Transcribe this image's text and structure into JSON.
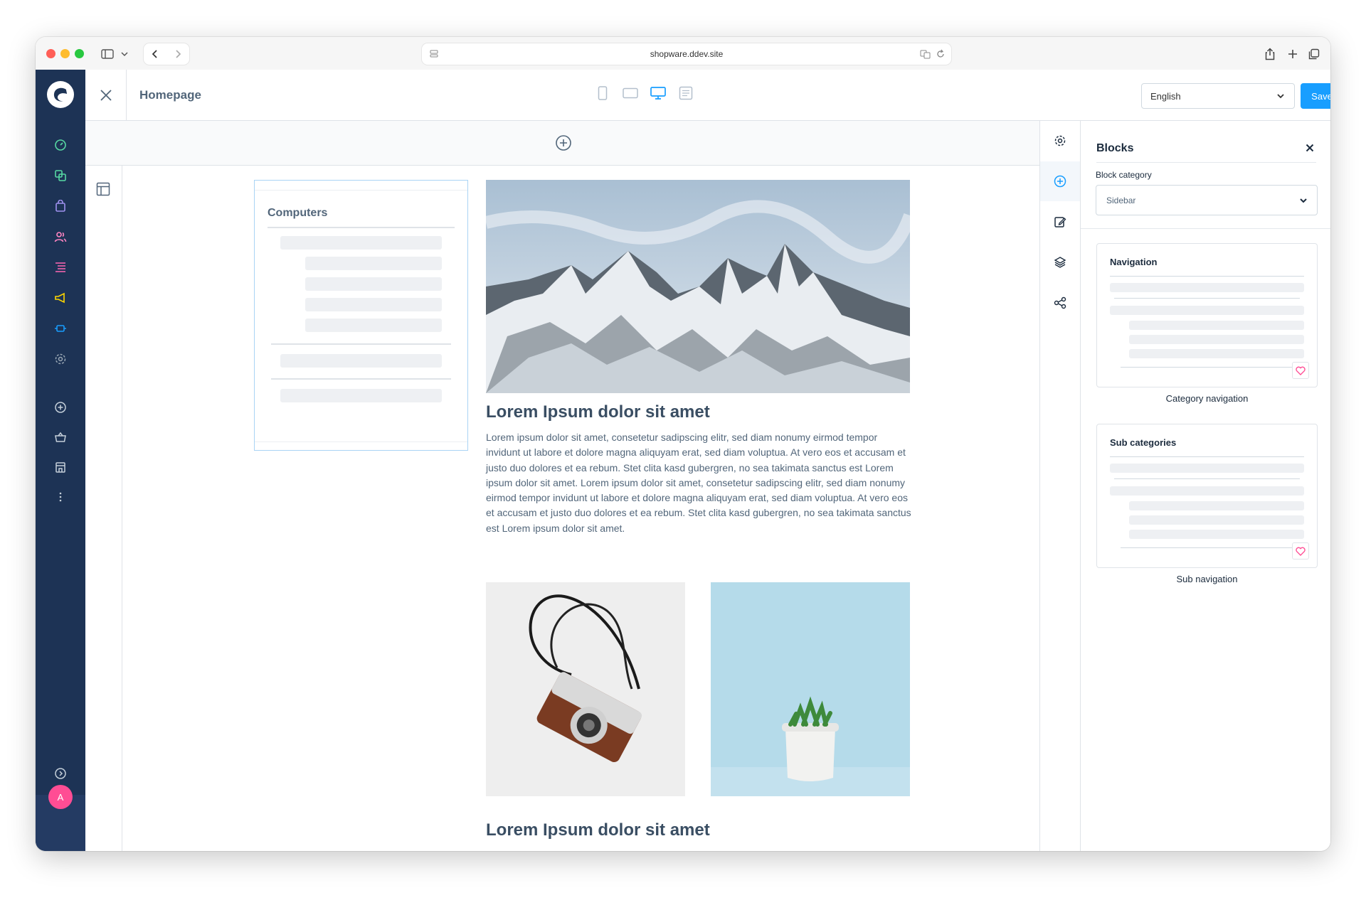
{
  "browser": {
    "url": "shopware.ddev.site"
  },
  "header": {
    "page_title": "Homepage",
    "language": "English",
    "save_label": "Save"
  },
  "content": {
    "category_block_title": "Computers",
    "heading_1": "Lorem Ipsum dolor sit amet",
    "paragraph": "Lorem ipsum dolor sit amet, consetetur sadipscing elitr, sed diam nonumy eirmod tempor invidunt ut labore et dolore magna aliquyam erat, sed diam voluptua. At vero eos et accusam et justo duo dolores et ea rebum. Stet clita kasd gubergren, no sea takimata sanctus est Lorem ipsum dolor sit amet. Lorem ipsum dolor sit amet, consetetur sadipscing elitr, sed diam nonumy eirmod tempor invidunt ut labore et dolore magna aliquyam erat, sed diam voluptua. At vero eos et accusam et justo duo dolores et ea rebum. Stet clita kasd gubergren, no sea takimata sanctus est Lorem ipsum dolor sit amet.",
    "heading_2": "Lorem Ipsum dolor sit amet"
  },
  "blocks_panel": {
    "title": "Blocks",
    "category_label": "Block category",
    "category_value": "Sidebar",
    "cards": [
      {
        "title": "Navigation",
        "caption": "Category navigation"
      },
      {
        "title": "Sub categories",
        "caption": "Sub navigation"
      }
    ]
  },
  "user": {
    "avatar_initial": "A"
  },
  "colors": {
    "sidebar": "#1d3355",
    "accent": "#189eff",
    "avatar": "#ff4d94"
  }
}
